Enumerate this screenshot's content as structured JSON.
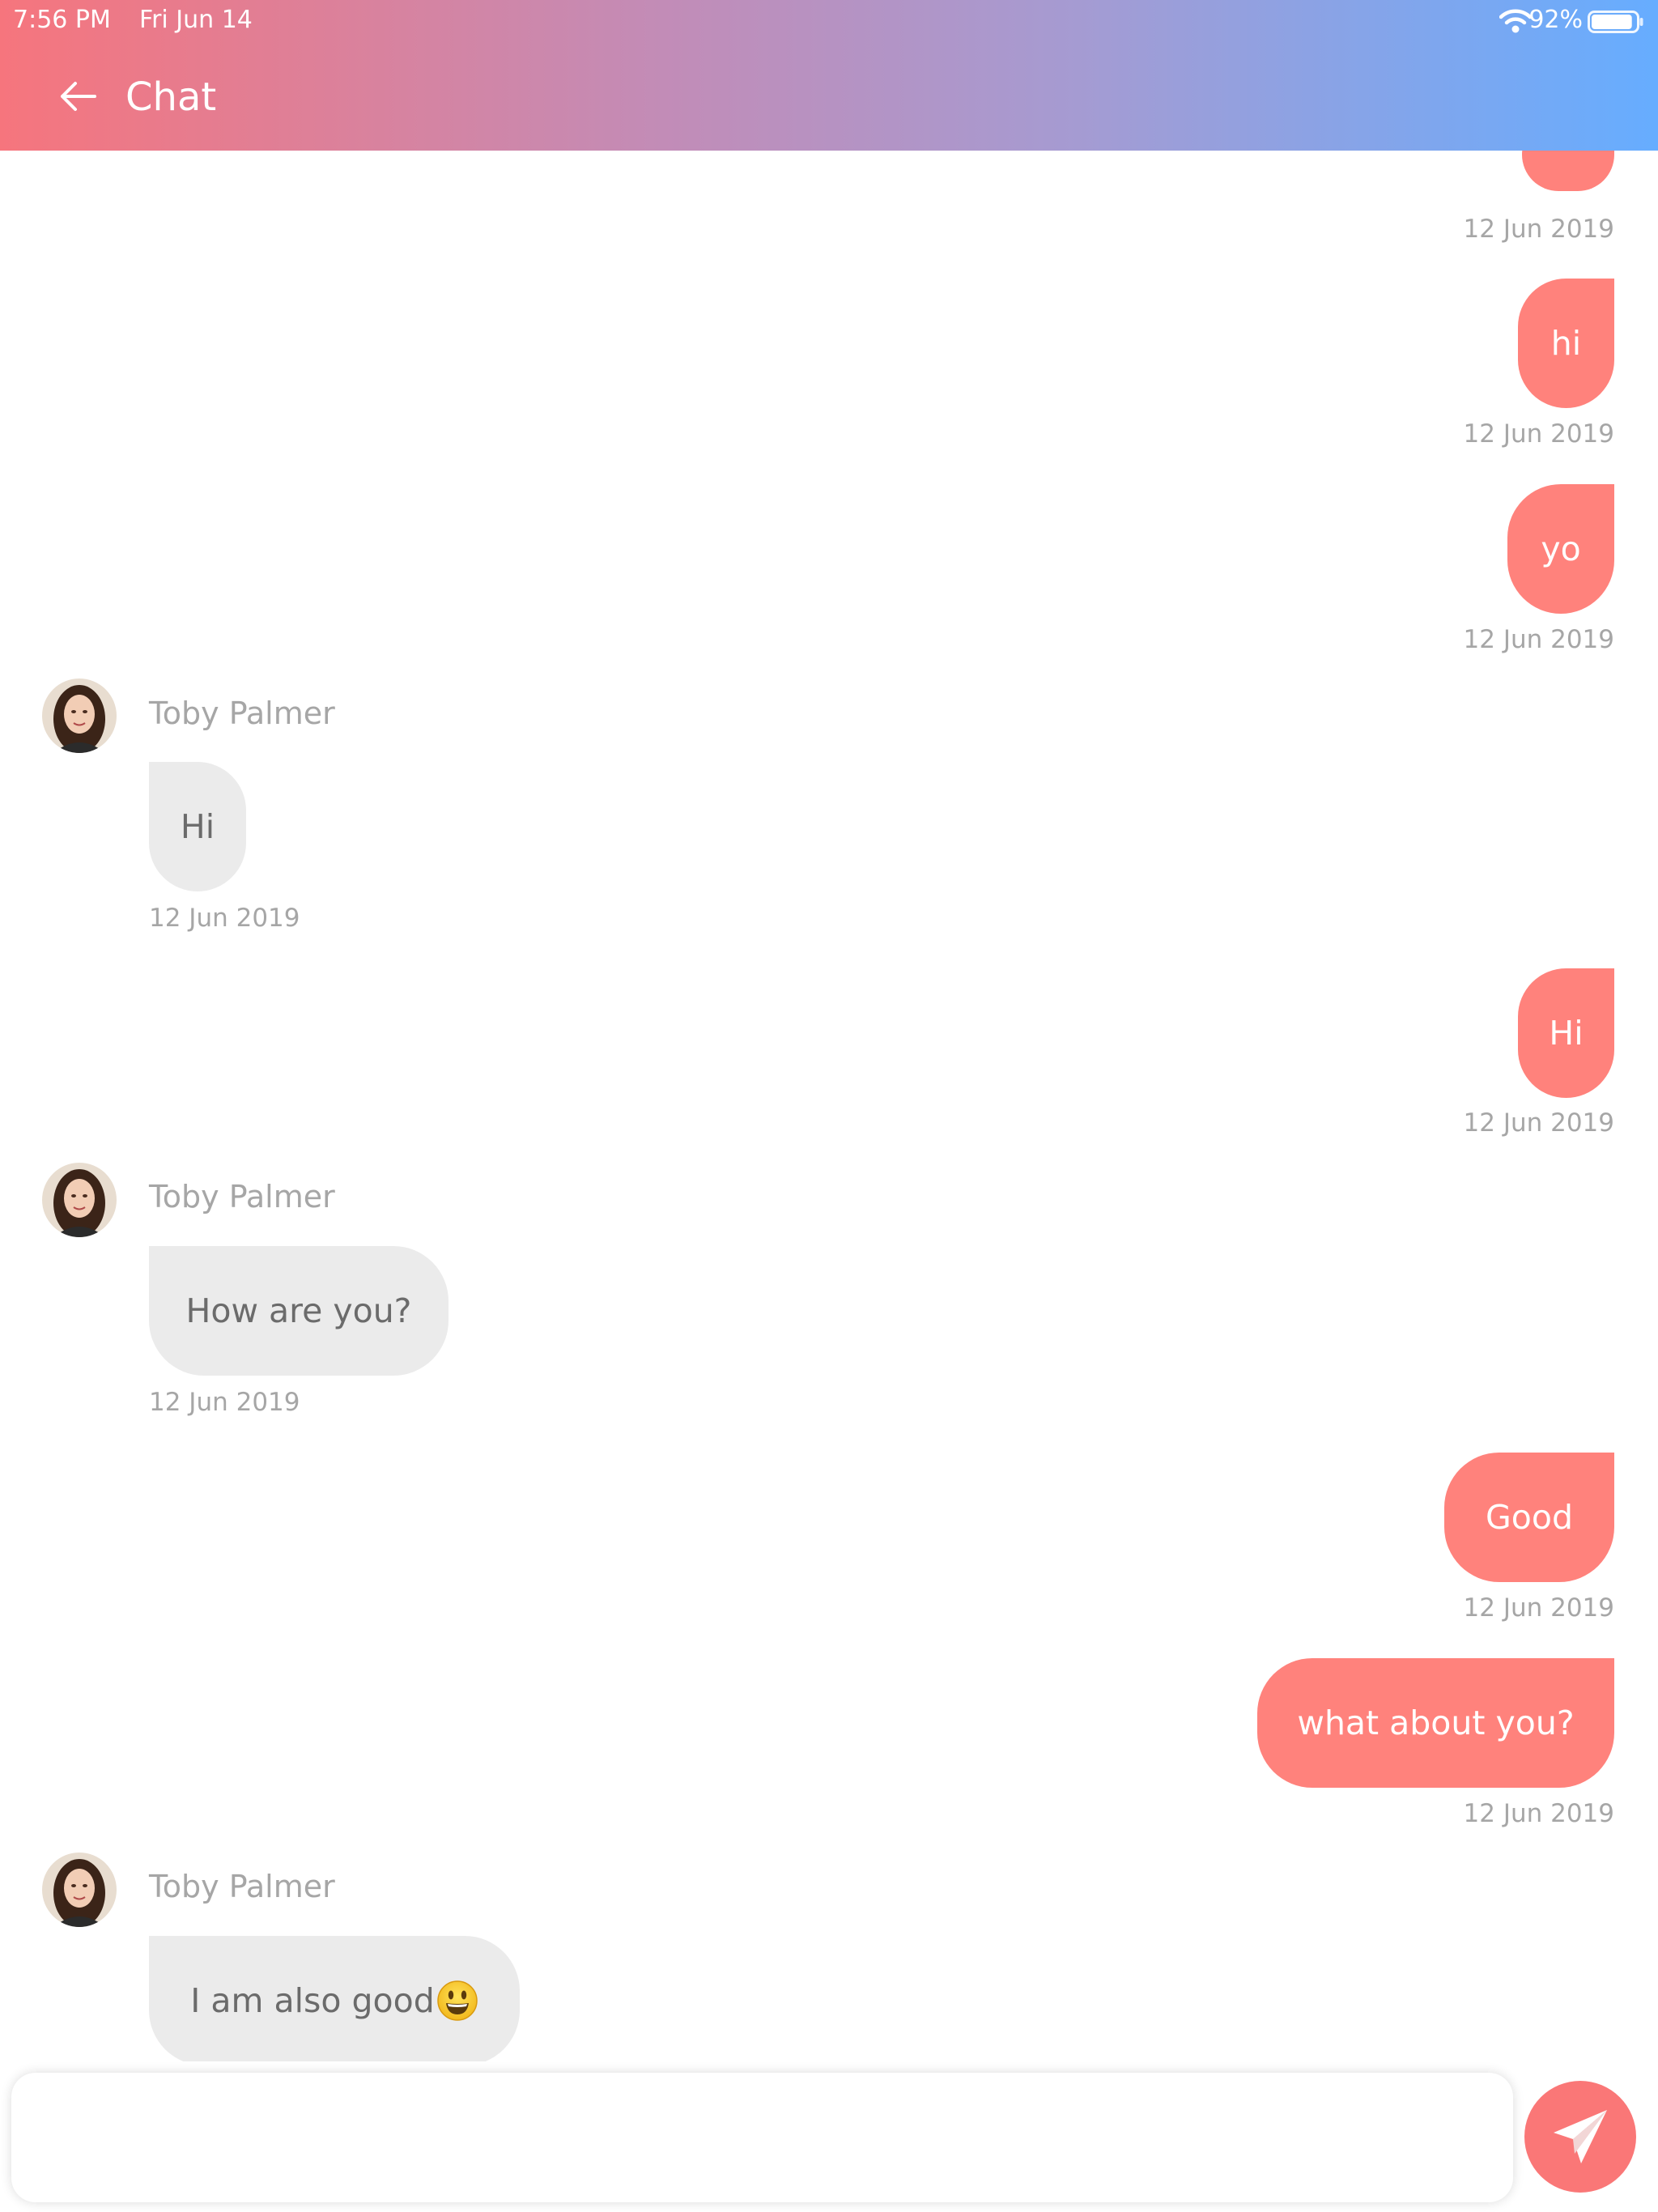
{
  "status_bar": {
    "time": "7:56 PM",
    "date": "Fri Jun 14",
    "battery_percent": "92%",
    "battery_level": 0.92
  },
  "header": {
    "title": "Chat",
    "back_icon": "arrow-left-icon"
  },
  "messages": [
    {
      "type": "sent",
      "text": "",
      "timestamp": "12 Jun 2019"
    },
    {
      "type": "sent",
      "text": "hi",
      "timestamp": "12 Jun 2019"
    },
    {
      "type": "sent",
      "text": "yo",
      "timestamp": "12 Jun 2019"
    },
    {
      "type": "received",
      "sender": "Toby Palmer",
      "text": "Hi",
      "timestamp": "12 Jun 2019"
    },
    {
      "type": "sent",
      "text": "Hi",
      "timestamp": "12 Jun 2019"
    },
    {
      "type": "received",
      "sender": "Toby Palmer",
      "text": "How are you?",
      "timestamp": "12 Jun 2019"
    },
    {
      "type": "sent",
      "text": "Good",
      "timestamp": "12 Jun 2019"
    },
    {
      "type": "sent",
      "text": "what about you?",
      "timestamp": "12 Jun 2019"
    },
    {
      "type": "received",
      "sender": "Toby Palmer",
      "text": "I am also good",
      "emoji": "smiley-emoji",
      "timestamp": ""
    }
  ],
  "composer": {
    "value": "",
    "placeholder": "",
    "send_icon": "paper-plane-icon"
  },
  "colors": {
    "header_gradient_start": "#f6757d",
    "header_gradient_end": "#66adff",
    "sent_bubble": "#ff827c",
    "received_bubble": "#ebebeb",
    "send_button": "#fa7777"
  }
}
